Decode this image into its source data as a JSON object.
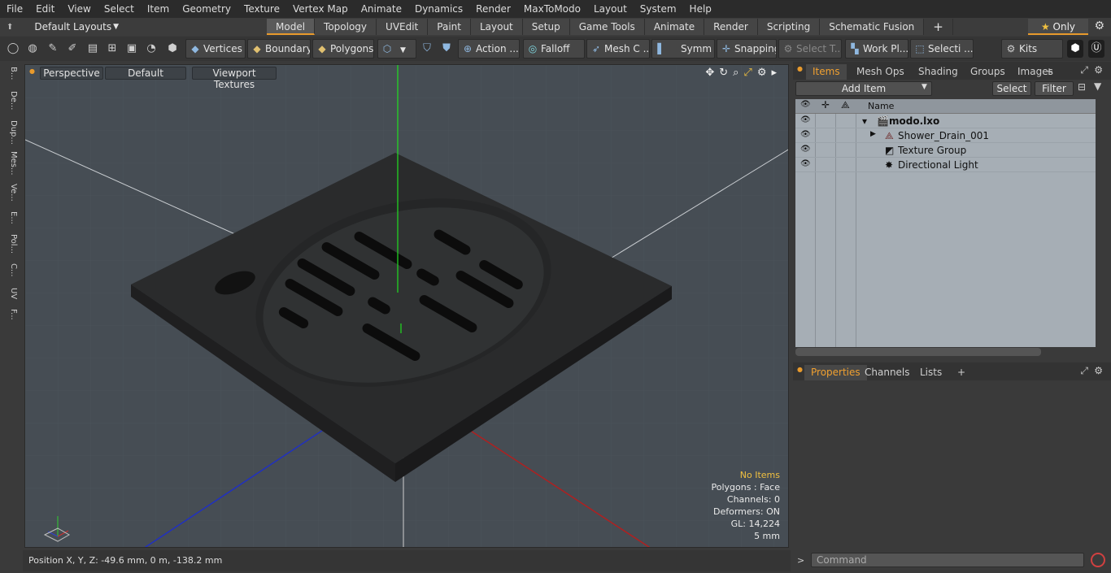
{
  "menu": [
    "File",
    "Edit",
    "View",
    "Select",
    "Item",
    "Geometry",
    "Texture",
    "Vertex Map",
    "Animate",
    "Dynamics",
    "Render",
    "MaxToModo",
    "Layout",
    "System",
    "Help"
  ],
  "layout_select": "Default Layouts",
  "mode_tabs": [
    "Model",
    "Topology",
    "UVEdit",
    "Paint",
    "Layout",
    "Setup",
    "Game Tools",
    "Animate",
    "Render",
    "Scripting",
    "Schematic Fusion"
  ],
  "active_mode_tab": "Model",
  "only_label": "Only",
  "toolbar": {
    "vertices": "Vertices",
    "boundary": "Boundary",
    "polygons": "Polygons",
    "action": "Action",
    "falloff": "Falloff",
    "mesh": "Mesh C ...",
    "symm": "Symm ...",
    "snapping": "Snapping",
    "select_t": "Select T...",
    "work_pl": "Work Pl...",
    "selecti": "Selecti ...",
    "kits": "Kits"
  },
  "left_tabs": [
    "B...",
    "De...",
    "Dup...",
    "Mes...",
    "Ve...",
    "E...",
    "Pol...",
    "C...",
    "UV",
    "F..."
  ],
  "viewport": {
    "view": "Perspective",
    "shading": "Default",
    "textures": "Viewport Textures",
    "info": {
      "no_items": "No Items",
      "polygons": "Polygons : Face",
      "channels": "Channels: 0",
      "deformers": "Deformers: ON",
      "gl": "GL: 14,224",
      "unit": "5 mm"
    }
  },
  "status": "Position X, Y, Z:   -49.6 mm, 0 m, -138.2 mm",
  "items_panel": {
    "tabs": [
      "Items",
      "Mesh Ops",
      "Shading",
      "Groups",
      "Images"
    ],
    "add_item": "Add Item",
    "select": "Select",
    "filter": "Filter",
    "name_col": "Name",
    "rows": [
      "modo.lxo",
      "Shower_Drain_001",
      "Texture Group",
      "Directional Light"
    ]
  },
  "props_panel": {
    "tabs": [
      "Properties",
      "Channels",
      "Lists"
    ]
  },
  "command_placeholder": "Command",
  "colors": {
    "accent": "#e89a2c",
    "viewport_bg": "#464d54",
    "list_bg": "#a6aeb5"
  }
}
